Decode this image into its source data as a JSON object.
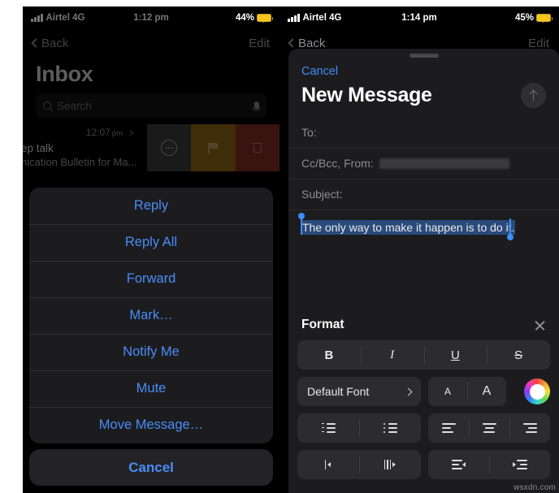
{
  "left_phone": {
    "status_bar": {
      "carrier": "Airtel 4G",
      "time": "1:12 pm",
      "battery": "44%"
    },
    "nav": {
      "back": "Back",
      "edit": "Edit"
    },
    "title": "Inbox",
    "search": {
      "placeholder": "Search",
      "value": ""
    },
    "mail_row": {
      "time": "12:07",
      "time_suffix": "pm",
      "line1": "ep talk",
      "line2": "nication Bulletin for Ma..."
    },
    "swipe_actions": [
      {
        "name": "more",
        "color": "#3a3a3c"
      },
      {
        "name": "flag",
        "color": "#8a6412"
      },
      {
        "name": "trash",
        "color": "#7d2a25"
      }
    ],
    "action_sheet": {
      "items": [
        {
          "label": "Reply"
        },
        {
          "label": "Reply All"
        },
        {
          "label": "Forward"
        },
        {
          "label": "Mark…"
        },
        {
          "label": "Notify Me"
        },
        {
          "label": "Mute"
        },
        {
          "label": "Move Message…"
        }
      ],
      "cancel": "Cancel"
    }
  },
  "right_phone": {
    "status_bar": {
      "carrier": "Airtel 4G",
      "time": "1:14 pm",
      "battery": "45%"
    },
    "nav": {
      "back": "Back",
      "edit": "Edit"
    },
    "composer": {
      "cancel": "Cancel",
      "title": "New Message",
      "fields": {
        "to_label": "To:",
        "to_value": "",
        "ccbcc_label": "Cc/Bcc, From:",
        "ccbcc_value": "",
        "subject_label": "Subject:",
        "subject_value": ""
      },
      "body_selected_text": "The only way to make it happen is to do it."
    },
    "format_panel": {
      "title": "Format",
      "style_buttons": [
        {
          "label": "B",
          "name": "bold"
        },
        {
          "label": "I",
          "name": "italic"
        },
        {
          "label": "U",
          "name": "underline"
        },
        {
          "label": "S",
          "name": "strikethrough"
        }
      ],
      "font_button": "Default Font",
      "size_buttons": [
        {
          "label": "A",
          "name": "decrease-size"
        },
        {
          "label": "A",
          "name": "increase-size"
        }
      ],
      "color_wheel": "color-picker",
      "list_buttons": [
        {
          "name": "numbered-list"
        },
        {
          "name": "bulleted-list"
        }
      ],
      "align_buttons": [
        {
          "name": "align-left"
        },
        {
          "name": "align-center"
        },
        {
          "name": "align-right"
        }
      ],
      "indent_markers": [
        {
          "name": "indent-marker-left"
        },
        {
          "name": "indent-marker-right"
        }
      ],
      "indent_buttons": [
        {
          "name": "decrease-indent"
        },
        {
          "name": "increase-indent"
        }
      ]
    },
    "watermark": "wsxdn.com"
  },
  "colors": {
    "accent_blue": "#4a8cf7",
    "selection_blue": "#3f8ef7",
    "sheet_bg": "#1c1c1e"
  }
}
